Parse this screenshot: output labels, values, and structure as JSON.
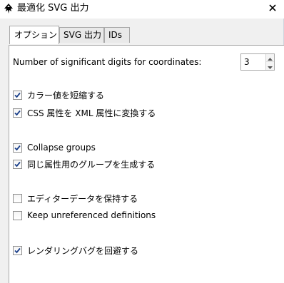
{
  "window": {
    "title": "最適化 SVG 出力",
    "app_icon": "inkscape-icon",
    "close_icon": "close-icon"
  },
  "tabs": [
    {
      "label": "オプション",
      "active": true
    },
    {
      "label": "SVG 出力",
      "active": false
    },
    {
      "label": "IDs",
      "active": false
    }
  ],
  "options": {
    "precision_label": "Number of significant digits for coordinates:",
    "precision_value": "3",
    "checkboxes": [
      {
        "label": "カラー値を短縮する",
        "checked": true
      },
      {
        "label": "CSS 属性を XML 属性に変換する",
        "checked": true
      },
      {
        "label": "Collapse groups",
        "checked": true
      },
      {
        "label": "同じ属性用のグループを生成する",
        "checked": true
      },
      {
        "label": "エディターデータを保持する",
        "checked": false
      },
      {
        "label": "Keep unreferenced definitions",
        "checked": false
      },
      {
        "label": "レンダリングバグを回避する",
        "checked": true
      }
    ]
  },
  "colors": {
    "check_mark": "#1a3f8a",
    "border": "#a9a9a9",
    "window_bg": "#f0f0f0"
  }
}
